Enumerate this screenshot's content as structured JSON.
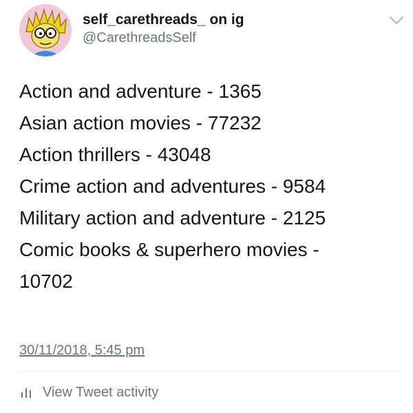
{
  "tweet": {
    "display_name": "self_carethreads_ on ig",
    "handle": "@CarethreadsSelf",
    "avatar_icon": "cartoon-face-avatar",
    "menu_icon": "chevron-down-icon",
    "lines": [
      "Action and adventure - 1365",
      "Asian action movies - 77232",
      "Action thrillers - 43048",
      "Crime action and adventures - 9584",
      "Military action and adventure - 2125",
      "Comic books & superhero movies -",
      "10702"
    ],
    "timestamp": "30/11/2018, 5:45 pm",
    "activity_label": "View Tweet activity",
    "activity_icon": "bar-chart-icon"
  },
  "colors": {
    "text": "#14171a",
    "secondary": "#657786",
    "divider": "#e1e8ed",
    "avatar_bg": "#f3c8d8"
  }
}
